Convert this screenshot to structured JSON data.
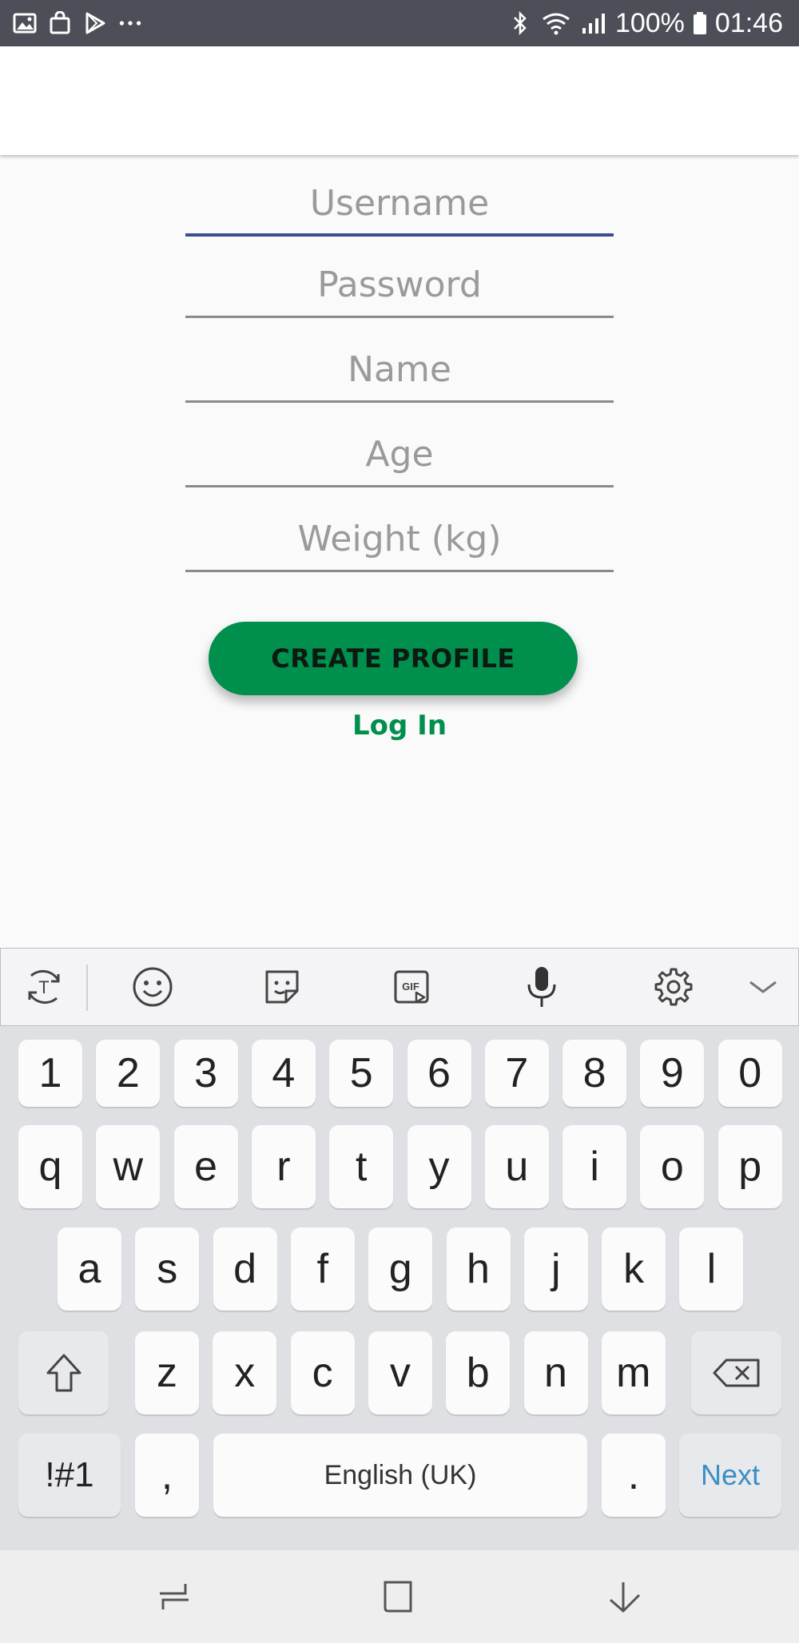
{
  "status_bar": {
    "left_icons": [
      "image-icon",
      "shopping-bag-icon",
      "play-store-icon",
      "more-dots-icon"
    ],
    "battery": "100%",
    "time": "01:46"
  },
  "form": {
    "username_placeholder": "Username",
    "password_placeholder": "Password",
    "name_placeholder": "Name",
    "age_placeholder": "Age",
    "weight_placeholder": "Weight (kg)",
    "create_button_label": "CREATE PROFILE",
    "login_link_label": "Log In"
  },
  "colors": {
    "primary_green": "#008f4c",
    "active_underline": "#3d4d8e",
    "status_bar": "#4c4f58"
  },
  "keyboard": {
    "toolbar_icons": [
      "text-translate-icon",
      "emoji-icon",
      "sticker-icon",
      "gif-icon",
      "microphone-icon",
      "settings-gear-icon",
      "collapse-chevron-icon"
    ],
    "row_numbers": [
      "1",
      "2",
      "3",
      "4",
      "5",
      "6",
      "7",
      "8",
      "9",
      "0"
    ],
    "row_1": [
      "q",
      "w",
      "e",
      "r",
      "t",
      "y",
      "u",
      "i",
      "o",
      "p"
    ],
    "row_2": [
      "a",
      "s",
      "d",
      "f",
      "g",
      "h",
      "j",
      "k",
      "l"
    ],
    "row_3": [
      "z",
      "x",
      "c",
      "v",
      "b",
      "n",
      "m"
    ],
    "symbols_label": "!#1",
    "comma_label": ",",
    "space_label": "English (UK)",
    "period_label": ".",
    "action_label": "Next"
  }
}
